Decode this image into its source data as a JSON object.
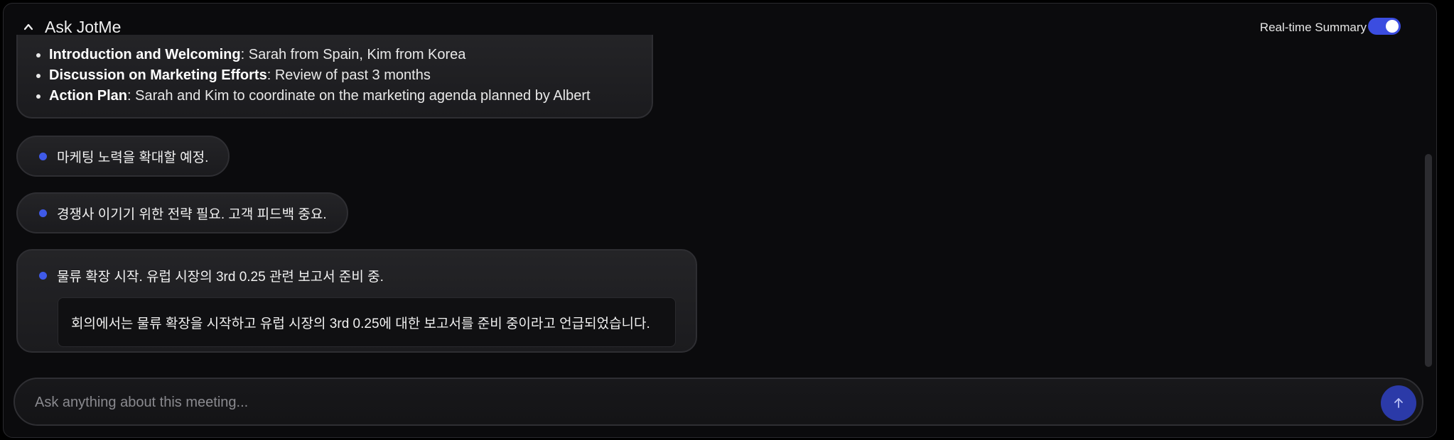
{
  "header": {
    "title": "Ask JotMe",
    "realtime_label": "Real-time Summary",
    "realtime_enabled": true
  },
  "summary": {
    "items": [
      {
        "heading": "Introduction and Welcoming",
        "text": ": Sarah from Spain, Kim from Korea"
      },
      {
        "heading": "Discussion on Marketing Efforts",
        "text": ": Review of past 3 months"
      },
      {
        "heading": "Action Plan",
        "text": ": Sarah and Kim to coordinate on the marketing agenda planned by Albert"
      }
    ]
  },
  "highlights": [
    {
      "text": "마케팅 노력을 확대할 예정."
    },
    {
      "text": "경쟁사 이기기 위한 전략 필요. 고객 피드백 중요."
    },
    {
      "text": "물류 확장 시작. 유럽 시장의 3rd 0.25 관련 보고서 준비 중.",
      "detail": "회의에서는 물류 확장을 시작하고 유럽 시장의 3rd 0.25에 대한 보고서를 준비 중이라고 언급되었습니다."
    }
  ],
  "input": {
    "placeholder": "Ask anything about this meeting..."
  },
  "colors": {
    "accent": "#3f5ae8",
    "toggle": "#3b4de0",
    "send": "#2b3aa8",
    "background": "#0b0b0d"
  },
  "icons": {
    "collapse": "chevron-up-icon",
    "send": "arrow-up-icon"
  }
}
